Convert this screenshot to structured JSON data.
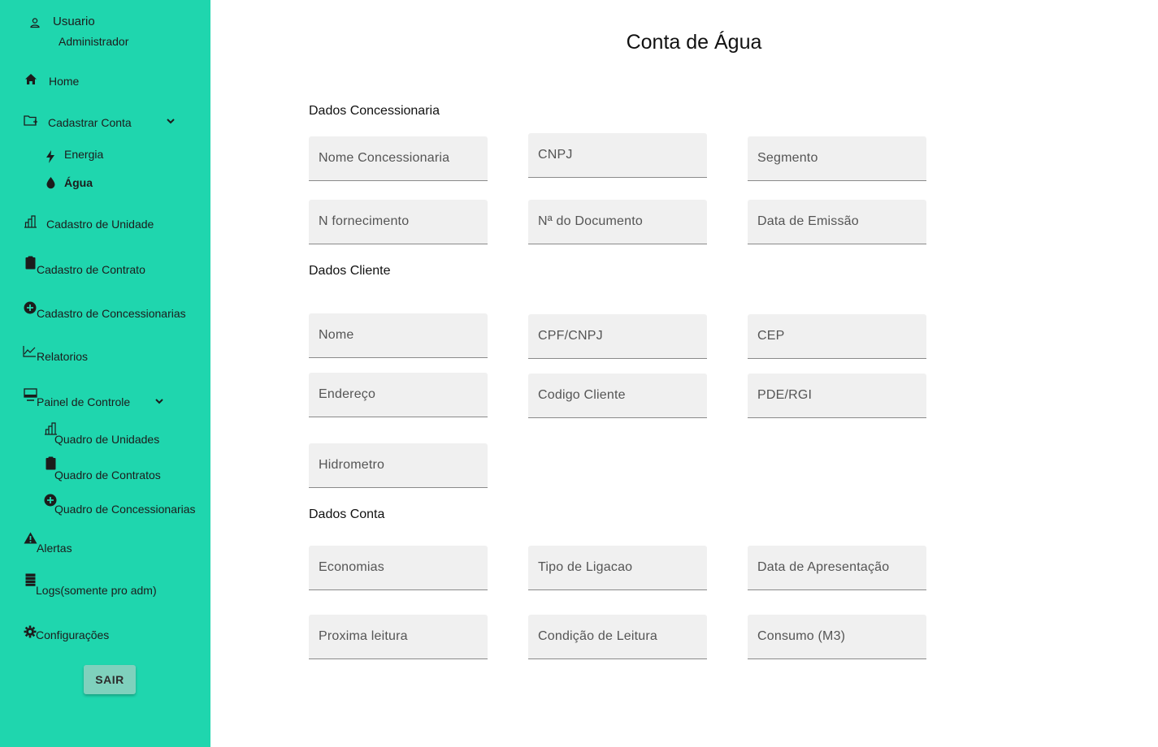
{
  "sidebar": {
    "user": {
      "name": "Usuario",
      "role": "Administrador"
    },
    "home": "Home",
    "cadastrar_conta": "Cadastrar Conta",
    "energia": "Energia",
    "agua": "Água",
    "cadastro_unidade": "Cadastro de Unidade",
    "cadastro_contrato": "Cadastro de Contrato",
    "cadastro_concessionarias": "Cadastro de Concessionarias",
    "relatorios": "Relatorios",
    "painel_controle": "Painel de Controle",
    "quadro_unidades": "Quadro de Unidades",
    "quadro_contratos": "Quadro de Contratos",
    "quadro_concessionarias": "Quadro de Concessionarias",
    "alertas": "Alertas",
    "logs": "Logs(somente pro adm)",
    "configuracoes": "Configurações",
    "sair": "SAIR"
  },
  "main": {
    "title": "Conta de Água",
    "sections": {
      "concessionaria": "Dados Concessionaria",
      "cliente": "Dados Cliente",
      "conta": "Dados Conta"
    },
    "fields": {
      "nome_concessionaria": "Nome Concessionaria",
      "cnpj": "CNPJ",
      "segmento": "Segmento",
      "n_fornecimento": "N fornecimento",
      "n_documento": "Nª do Documento",
      "data_emissao": "Data de Emissão",
      "nome": "Nome",
      "cpf_cnpj": "CPF/CNPJ",
      "cep": "CEP",
      "endereco": "Endereço",
      "codigo_cliente": "Codigo Cliente",
      "pde_rgi": "PDE/RGI",
      "hidrometro": "Hidrometro",
      "economias": "Economias",
      "tipo_ligacao": "Tipo de Ligacao",
      "data_apresentacao": "Data de Apresentação",
      "proxima_leitura": "Proxima leitura",
      "condicao_leitura": "Condição de Leitura",
      "consumo": "Consumo (M3)"
    }
  }
}
